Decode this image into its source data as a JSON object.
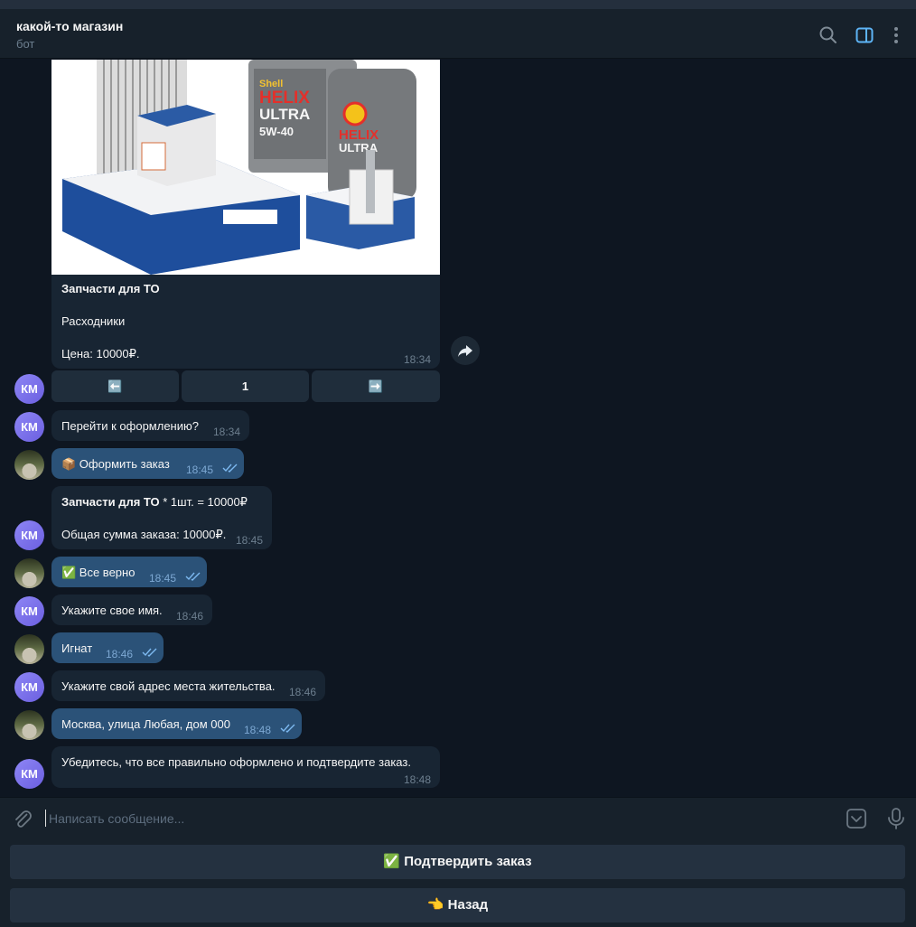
{
  "header": {
    "title": "какой-то магазин",
    "subtitle": "бот"
  },
  "product": {
    "name": "Запчасти для ТО",
    "category": "Расходники",
    "price": "Цена: 10000₽.",
    "time": "18:34"
  },
  "pagination": {
    "prev": "⬅️",
    "page": "1",
    "next": "➡️"
  },
  "avatar_initials": "КМ",
  "messages": [
    {
      "text": "Перейти к оформлению?",
      "time": "18:34"
    },
    {
      "text": "📦 Оформить заказ",
      "time": "18:45"
    },
    {
      "title": "Запчасти для ТО",
      "rest": " * 1шт. = 10000₽",
      "total": "Общая сумма заказа: 10000₽.",
      "time": "18:45"
    },
    {
      "text": "✅ Все верно",
      "time": "18:45"
    },
    {
      "text": "Укажите свое имя.",
      "time": "18:46"
    },
    {
      "text": "Игнат",
      "time": "18:46"
    },
    {
      "text": "Укажите свой адрес места жительства.",
      "time": "18:46"
    },
    {
      "text": "Москва, улица Любая, дом 000",
      "time": "18:48"
    },
    {
      "text": "Убедитесь, что все правильно оформлено и подтвердите заказ.",
      "time": "18:48"
    }
  ],
  "input": {
    "placeholder": "Написать сообщение..."
  },
  "reply_keyboard": {
    "confirm": "✅ Подтвердить заказ",
    "back": "👈 Назад"
  },
  "colors": {
    "background": "#0e1621",
    "incoming_bubble": "#182533",
    "outgoing_bubble": "#2b5278",
    "accent": "#5eb5f7"
  },
  "icons": [
    "search-icon",
    "sidebar-toggle-icon",
    "more-icon",
    "share-icon",
    "attach-icon",
    "bot-keyboard-icon",
    "microphone-icon",
    "double-check-icon"
  ]
}
